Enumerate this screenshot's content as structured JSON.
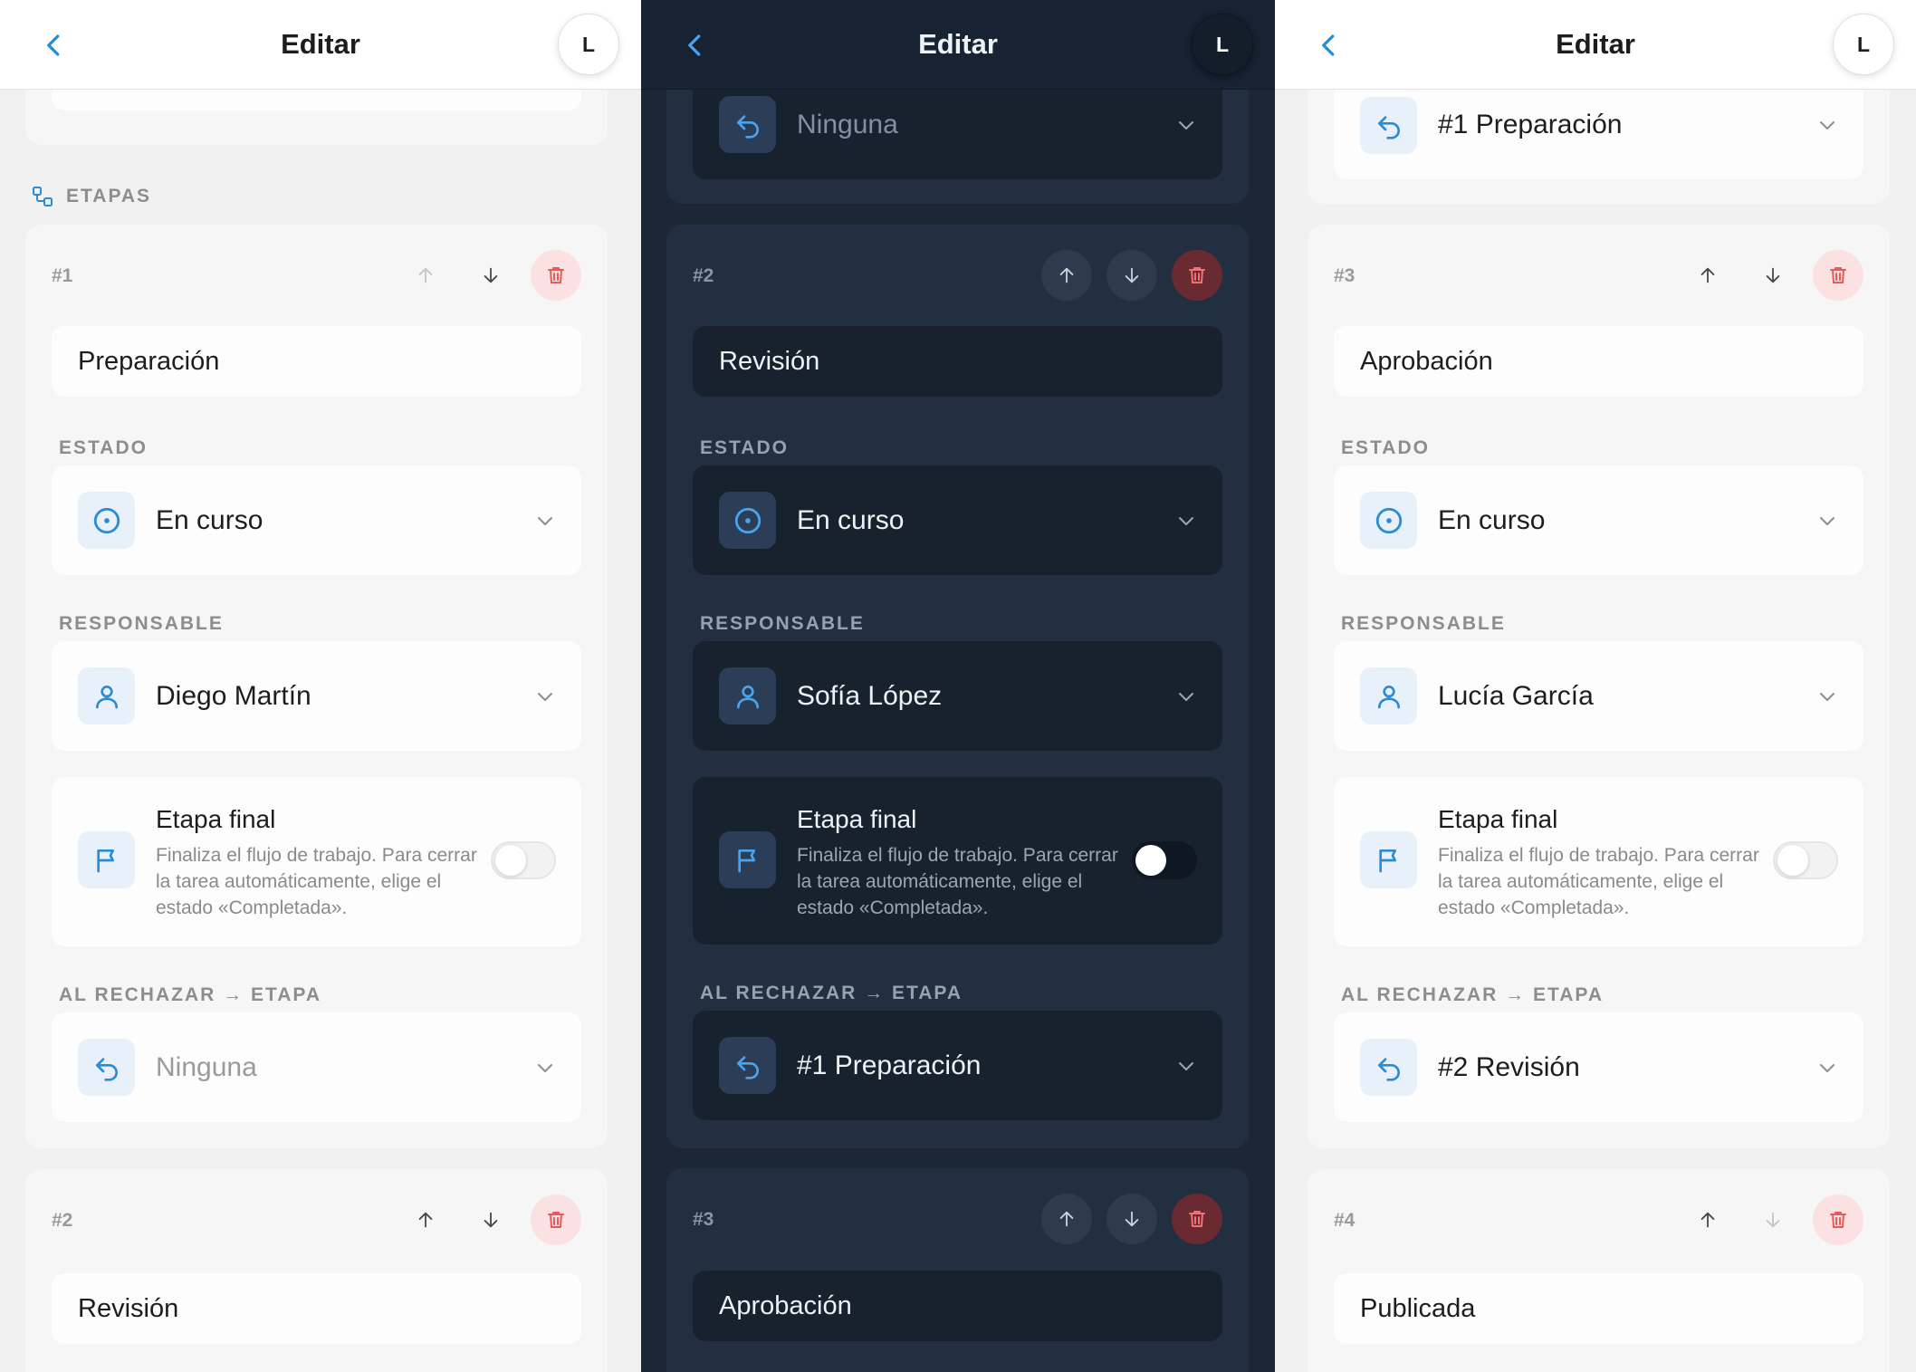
{
  "colors": {
    "accent": "#2a8bd6",
    "delete_light": "#e65a5a",
    "delete_dark": "#f07373",
    "dark_bg": "#1c2736",
    "light_bg": "#f1f1f1"
  },
  "header": {
    "title": "Editar",
    "avatar_initial": "L",
    "back_icon": "chevron-left-icon"
  },
  "labels": {
    "stages_section": "ETAPAS",
    "status": "ESTADO",
    "owner": "RESPONSABLE",
    "on_reject": "AL RECHAZAR → ETAPA",
    "final_title": "Etapa final",
    "final_desc": "Finaliza el flujo de trabajo. Para cerrar la tarea automáticamente, elige el estado «Completada»."
  },
  "screen1": {
    "top_card_value": "",
    "stage": {
      "number": "#1",
      "name": "Preparación",
      "status": "En curso",
      "owner": "Diego Martín",
      "is_final": false,
      "on_reject": "Ninguna"
    },
    "next_stage": {
      "number": "#2",
      "name": "Revisión"
    }
  },
  "screen2": {
    "top_reject_value": "Ninguna",
    "stage": {
      "number": "#2",
      "name": "Revisión",
      "status": "En curso",
      "owner": "Sofía López",
      "is_final": false,
      "on_reject": "#1 Preparación"
    },
    "next_stage": {
      "number": "#3",
      "name": "Aprobación"
    }
  },
  "screen3": {
    "top_reject_value": "#1 Preparación",
    "stage": {
      "number": "#3",
      "name": "Aprobación",
      "status": "En curso",
      "owner": "Lucía García",
      "is_final": false,
      "on_reject": "#2 Revisión"
    },
    "next_stage": {
      "number": "#4",
      "name": "Publicada"
    }
  }
}
